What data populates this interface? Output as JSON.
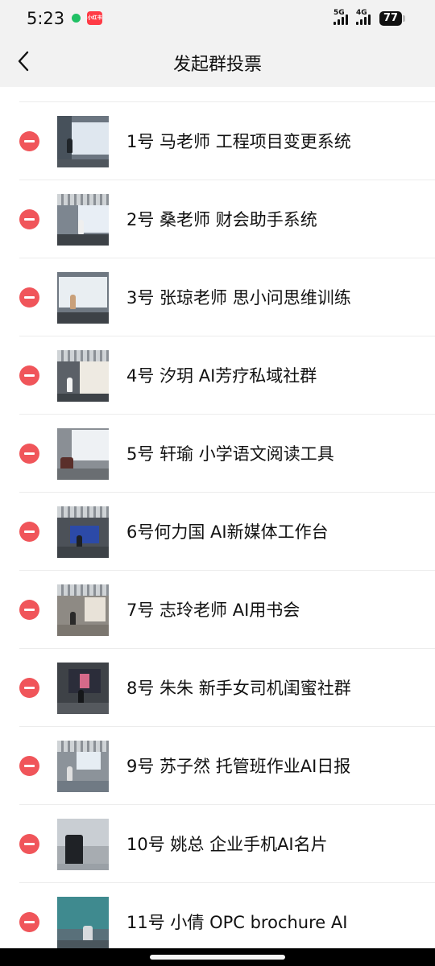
{
  "status": {
    "time": "5:23",
    "app_badge": "小红书",
    "net1": "5G",
    "net2": "4G",
    "battery": "77"
  },
  "nav": {
    "title": "发起群投票"
  },
  "colors": {
    "remove": "#f0555a",
    "nav_bg": "#f2f2f2",
    "divider": "#ececec"
  },
  "items": [
    {
      "label": "1号 马老师 工程项目变更系统",
      "icon": "remove-icon"
    },
    {
      "label": "2号 桑老师 财会助手系统",
      "icon": "remove-icon"
    },
    {
      "label": "3号 张琼老师 思小问思维训练",
      "icon": "remove-icon"
    },
    {
      "label": "4号 汐玥 AI芳疗私域社群",
      "icon": "remove-icon"
    },
    {
      "label": "5号 轩瑜 小学语文阅读工具",
      "icon": "remove-icon"
    },
    {
      "label": "6号何力国 AI新媒体工作台",
      "icon": "remove-icon"
    },
    {
      "label": "7号 志玲老师 AI用书会",
      "icon": "remove-icon"
    },
    {
      "label": "8号 朱朱 新手女司机闺蜜社群",
      "icon": "remove-icon"
    },
    {
      "label": "9号 苏子然 托管班作业AI日报",
      "icon": "remove-icon"
    },
    {
      "label": "10号 姚总  企业手机AI名片",
      "icon": "remove-icon"
    },
    {
      "label": "11号 小倩  OPC brochure AI",
      "icon": "remove-icon"
    }
  ]
}
